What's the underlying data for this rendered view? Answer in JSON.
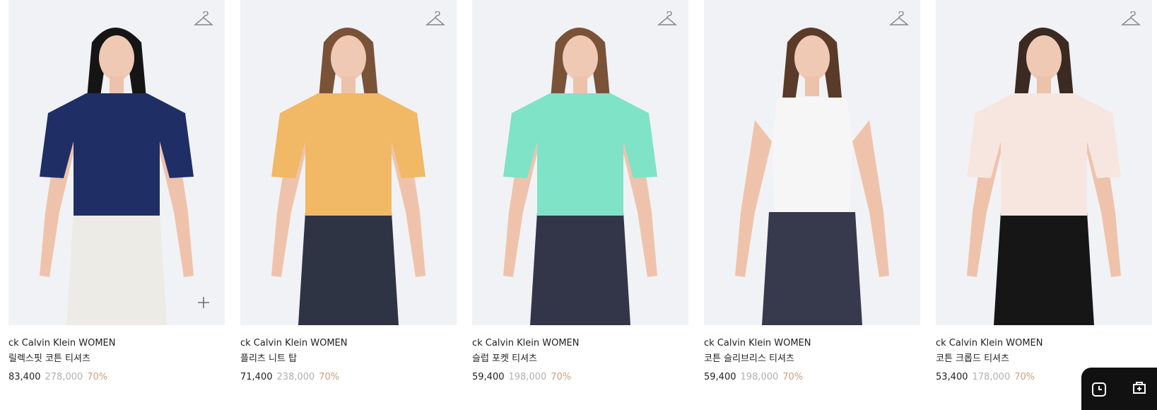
{
  "products": [
    {
      "brand": "ck Calvin Klein WOMEN",
      "name": "릴렉스핏 코튼 티셔츠",
      "price": "83,400",
      "original_price": "278,000",
      "discount": "70%",
      "top_color": "#1f2f66",
      "bottom_color": "#ecebe6",
      "hair_color": "#151515",
      "has_plus": true
    },
    {
      "brand": "ck Calvin Klein WOMEN",
      "name": "플리츠 니트 탑",
      "price": "71,400",
      "original_price": "238,000",
      "discount": "70%",
      "top_color": "#f1b866",
      "bottom_color": "#2f3444",
      "hair_color": "#7a5238",
      "has_plus": false
    },
    {
      "brand": "ck Calvin Klein WOMEN",
      "name": "슬럽 포켓 티셔츠",
      "price": "59,400",
      "original_price": "198,000",
      "discount": "70%",
      "top_color": "#7fe3c7",
      "bottom_color": "#323648",
      "hair_color": "#7a5238",
      "has_plus": false
    },
    {
      "brand": "ck Calvin Klein WOMEN",
      "name": "코튼 슬리브리스 티셔츠",
      "price": "59,400",
      "original_price": "198,000",
      "discount": "70%",
      "top_color": "#f6f6f6",
      "bottom_color": "#363a4c",
      "hair_color": "#5a3a28",
      "has_plus": false
    },
    {
      "brand": "ck Calvin Klein WOMEN",
      "name": "코튼 크롭드 티셔츠",
      "price": "53,400",
      "original_price": "178,000",
      "discount": "70%",
      "top_color": "#f7e6df",
      "bottom_color": "#161616",
      "hair_color": "#3a2a22",
      "has_plus": false
    }
  ],
  "icons": {
    "wishlist": "hanger-icon",
    "quick_add": "plus-icon",
    "recent": "clock-icon",
    "store": "store-icon"
  }
}
